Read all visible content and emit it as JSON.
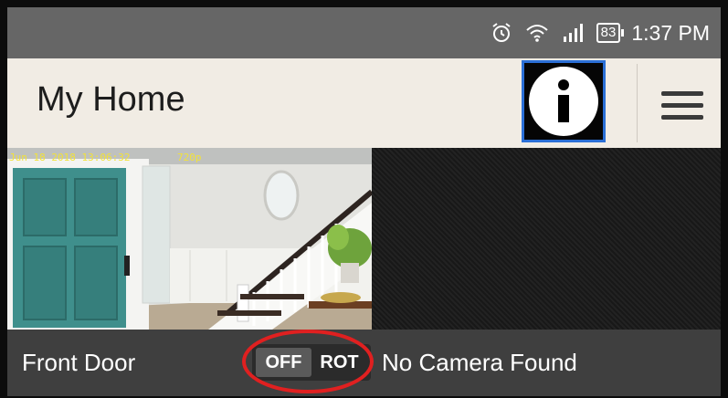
{
  "status_bar": {
    "battery": "83",
    "time": "1:37 PM",
    "icons": [
      "alarm-icon",
      "wifi-icon",
      "signal-icon",
      "battery-icon"
    ]
  },
  "app_bar": {
    "title": "My Home",
    "info_icon": "info-icon",
    "menu_icon": "hamburger-menu-icon"
  },
  "cameras": {
    "left": {
      "timestamp": "Jun 18 2018 13:06:32",
      "resolution": "720p"
    }
  },
  "bottom_bar": {
    "camera_name": "Front Door",
    "toggle_off": "OFF",
    "toggle_rot": "ROT",
    "no_camera": "No Camera Found"
  },
  "colors": {
    "status_bar": "#666666",
    "app_bar": "#f1ece4",
    "bottom_bar": "#3f3f3f",
    "highlight_ellipse": "#e02020",
    "info_border": "#2b6fd6"
  }
}
